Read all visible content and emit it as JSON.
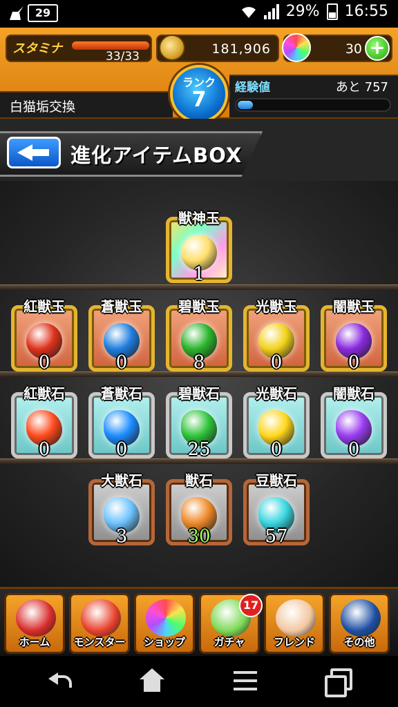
{
  "status_bar": {
    "calendar_day": "29",
    "battery": "29%",
    "time": "16:55"
  },
  "header": {
    "stamina_label": "スタミナ",
    "stamina_value": "33/33",
    "stamina_fill": 1.0,
    "coins": "181,906",
    "orbs": "30",
    "add_label": "+",
    "player_name": "白猫垢交換",
    "rank_label": "ランク",
    "rank_value": "7",
    "exp_label": "経験値",
    "exp_remaining": "あと 757",
    "exp_fill": 0.1
  },
  "title": {
    "text": "進化アイテムBOX"
  },
  "sections": {
    "top": [
      {
        "name": "獣神玉",
        "count": "1",
        "color": "#ffdf6a"
      }
    ],
    "orbs": [
      {
        "name": "紅獣玉",
        "count": "0",
        "color": "#e0321c"
      },
      {
        "name": "蒼獣玉",
        "count": "0",
        "color": "#1f7fe0"
      },
      {
        "name": "碧獣玉",
        "count": "8",
        "color": "#2bb52b"
      },
      {
        "name": "光獣玉",
        "count": "0",
        "color": "#f2d21a"
      },
      {
        "name": "闇獣玉",
        "count": "0",
        "color": "#8a2ae0"
      }
    ],
    "stones": [
      {
        "name": "紅獣石",
        "count": "0",
        "color": "#ff4a1c"
      },
      {
        "name": "蒼獣石",
        "count": "0",
        "color": "#1c8cff"
      },
      {
        "name": "碧獣石",
        "count": "25",
        "color": "#2ec43a"
      },
      {
        "name": "光獣石",
        "count": "0",
        "color": "#ffd71c"
      },
      {
        "name": "闇獣石",
        "count": "0",
        "color": "#9a3cf0"
      }
    ],
    "misc": [
      {
        "name": "大獣石",
        "count": "3",
        "color": "#6fc3ff"
      },
      {
        "name": "獣石",
        "count": "30",
        "color": "#f08a2a"
      },
      {
        "name": "豆獣石",
        "count": "57",
        "color": "#3ad6e0"
      }
    ]
  },
  "nav": [
    {
      "label": "ホーム",
      "icon": "home-dragon-icon",
      "color": "#d92a2a"
    },
    {
      "label": "モンスター",
      "icon": "monster-icon",
      "color": "#e8402a"
    },
    {
      "label": "ショップ",
      "icon": "rainbow-orb-icon",
      "color": "#ffffff"
    },
    {
      "label": "ガチャ",
      "icon": "gacha-egg-icon",
      "color": "#7ed957"
    },
    {
      "label": "フレンド",
      "icon": "handshake-icon",
      "color": "#f2c7a0"
    },
    {
      "label": "その他",
      "icon": "radar-icon",
      "color": "#1d4fa3"
    }
  ],
  "gacha_badge": "17"
}
